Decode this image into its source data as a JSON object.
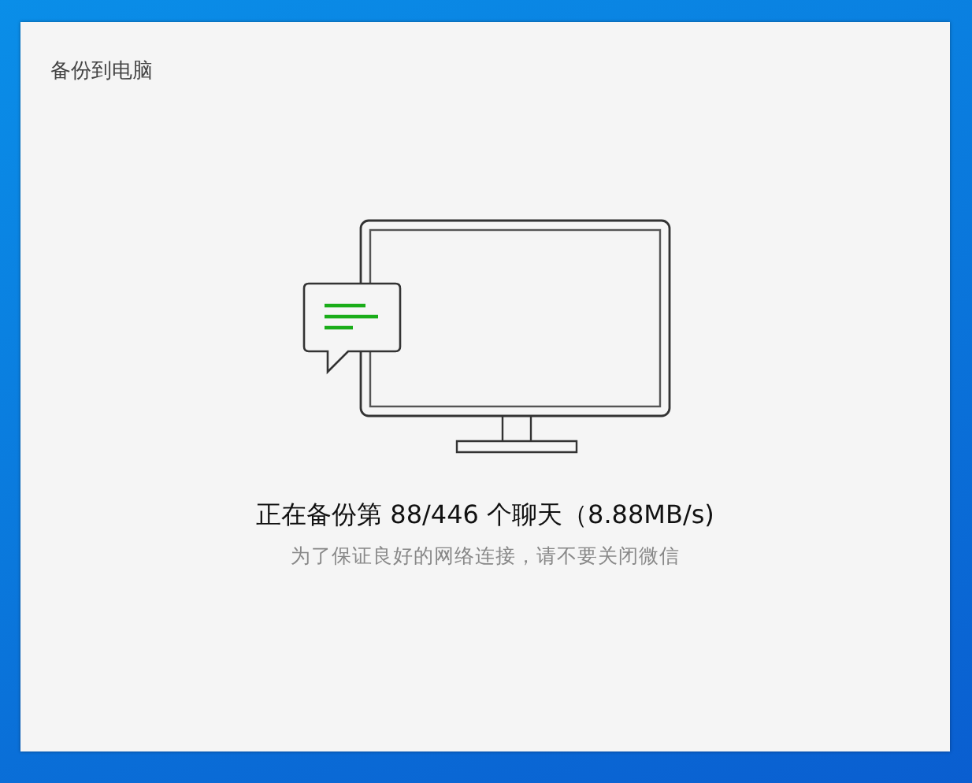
{
  "dialog": {
    "title": "备份到电脑",
    "status": "正在备份第 88/446 个聊天（8.88MB/s)",
    "hint": "为了保证良好的网络连接，请不要关闭微信"
  }
}
